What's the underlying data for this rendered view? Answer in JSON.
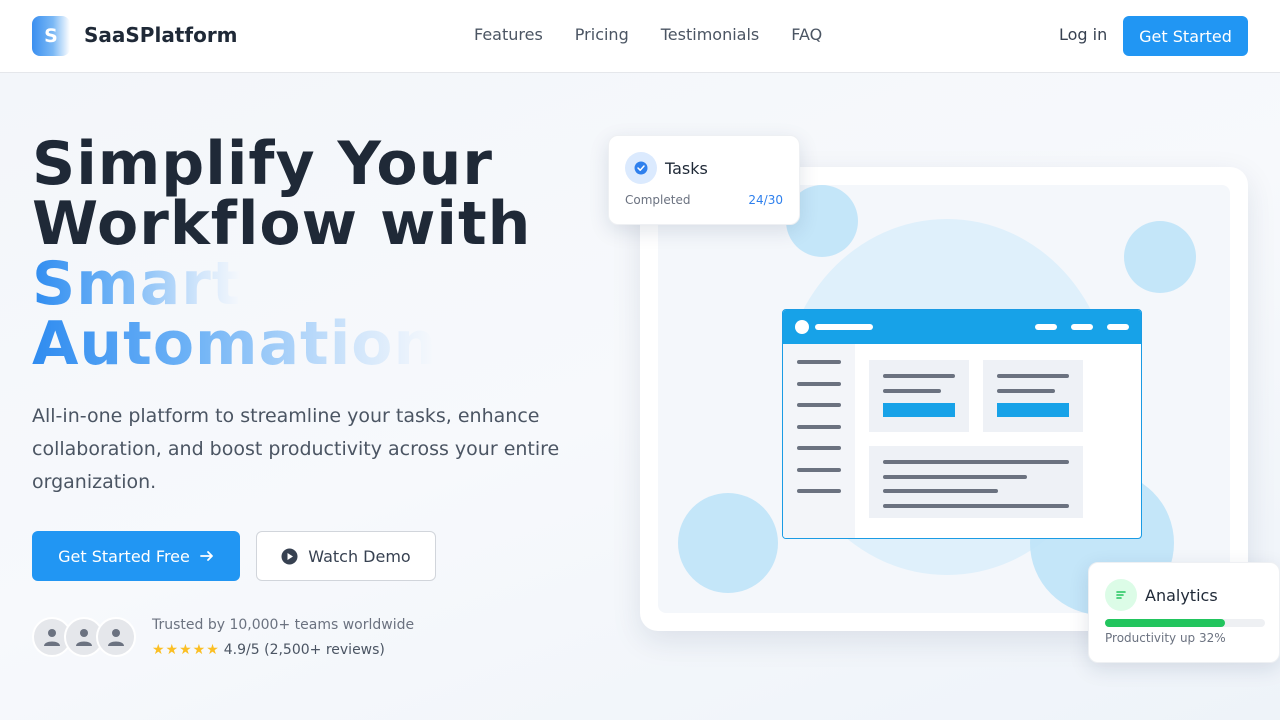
{
  "nav": {
    "logo_letter": "S",
    "brand": "SaaSPlatform",
    "links": [
      "Features",
      "Pricing",
      "Testimonials",
      "FAQ"
    ],
    "login": "Log in",
    "cta": "Get Started"
  },
  "hero": {
    "headline_line1": "Simplify Your",
    "headline_line2": "Workflow with",
    "headline_accent1": "Smart",
    "headline_accent2": "Automation",
    "subtitle": "All-in-one platform to streamline your tasks, enhance collaboration, and boost productivity across your entire organization.",
    "primary_button": "Get Started Free",
    "secondary_button": "Watch Demo",
    "trust_text": "Trusted by 10,000+ teams worldwide",
    "stars": "★★★★★",
    "rating_text": "4.9/5 (2,500+ reviews)"
  },
  "tasks_card": {
    "title": "Tasks",
    "label": "Completed",
    "count": "24/30"
  },
  "analytics_card": {
    "title": "Analytics",
    "progress_fraction": 0.75,
    "caption": "Productivity up 32%"
  },
  "colors": {
    "accent": "#2196f3",
    "illustration_blue": "#17a2e8",
    "progress_green": "#22c55e",
    "star_yellow": "#fbbf24"
  },
  "icons": [
    "arrow-right-icon",
    "play-icon",
    "user-icon",
    "check-icon",
    "chart-icon"
  ]
}
